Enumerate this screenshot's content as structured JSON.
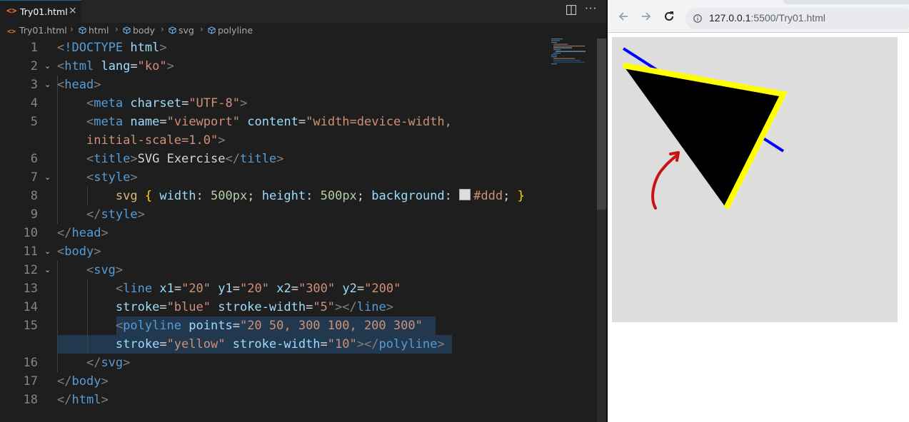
{
  "editor": {
    "tab_icon": "<>",
    "tab_name": "Try01.html",
    "tab_close": "×",
    "more": "···",
    "breadcrumb": {
      "file_icon": "<>",
      "file": "Try01.html",
      "items": [
        "html",
        "body",
        "svg",
        "polyline"
      ]
    },
    "line_numbers": [
      "1",
      "2",
      "3",
      "4",
      "5",
      "",
      "6",
      "7",
      "8",
      "9",
      "10",
      "11",
      "12",
      "13",
      "14",
      "15",
      "",
      "16",
      "17",
      "18"
    ],
    "swatch_color": "#dddddd"
  },
  "browser": {
    "url_host": "127.0.0.1",
    "url_rest": ":5500/Try01.html",
    "svg": {
      "background": "#dddddd",
      "line_stroke": "#0000ff",
      "polyline_stroke": "#ffff00",
      "polyline_fill": "#000000",
      "annotation_arrow_color": "#cc1111"
    }
  }
}
